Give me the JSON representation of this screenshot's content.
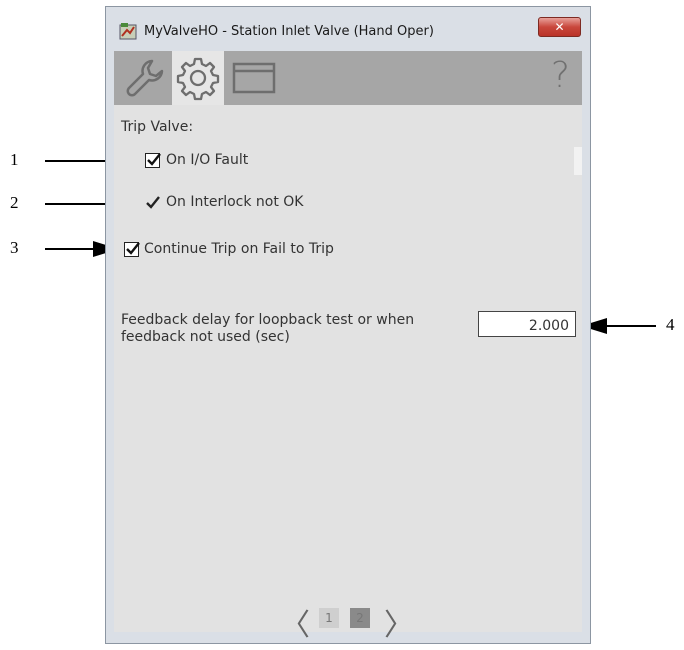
{
  "window": {
    "title": "MyValveHO - Station Inlet Valve (Hand Oper)",
    "close_label": "✕"
  },
  "toolbar": {
    "tabs": [
      {
        "icon": "wrench-icon"
      },
      {
        "icon": "gear-icon",
        "active": true
      },
      {
        "icon": "window-icon"
      }
    ],
    "help_label": "?"
  },
  "panel": {
    "section_label": "Trip Valve:",
    "options": [
      {
        "label": "On I/O Fault",
        "checked": true,
        "editable": true
      },
      {
        "label": "On Interlock not OK",
        "checked": true,
        "editable": false
      },
      {
        "label": "Continue Trip on Fail to Trip",
        "checked": true,
        "editable": true
      }
    ],
    "feedback_delay": {
      "label_line1": "Feedback delay for loopback test or when",
      "label_line2": "feedback not used (sec)",
      "value": "2.000"
    }
  },
  "pager": {
    "prev": "〈",
    "next": "〉",
    "pages": [
      "1",
      "2"
    ],
    "current_page": "2"
  },
  "callouts": [
    "1",
    "2",
    "3",
    "4"
  ]
}
